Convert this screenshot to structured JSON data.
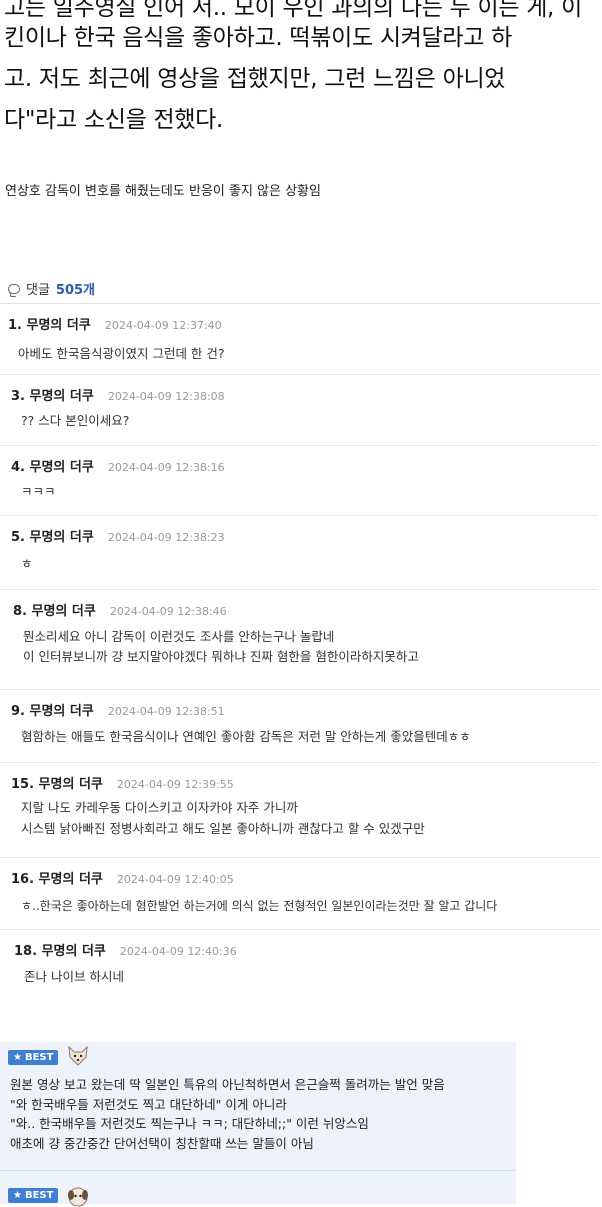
{
  "article": {
    "lines": [
      "고는 일주영실 인어 서.. 모이 우인 과의의 다는 두 이는 게, 이",
      "킨이나 한국 음식을 좋아하고. 떡볶이도 시켜달라고 하",
      "고. 저도 최근에 영상을 접했지만, 그런 느낌은 아니었",
      "다\"라고 소신을 전했다."
    ],
    "caption": "연상호 감독이 변호를 해줬는데도 반응이 좋지 않은 상황임"
  },
  "comments_header": {
    "label": "댓글",
    "count": "505개"
  },
  "comments": [
    {
      "author": "1. 무명의 더쿠",
      "date": "2024-04-09 12:37:40",
      "lines": [
        "아베도 한국음식광이였지 그런데 한 건?"
      ]
    },
    {
      "author": "3. 무명의 더쿠",
      "date": "2024-04-09 12:38:08",
      "lines": [
        "?? 스다 본인이세요?"
      ]
    },
    {
      "author": "4. 무명의 더쿠",
      "date": "2024-04-09 12:38:16",
      "lines": [
        "ㅋㅋㅋ"
      ]
    },
    {
      "author": "5. 무명의 더쿠",
      "date": "2024-04-09 12:38:23",
      "lines": [
        "ㅎ"
      ]
    },
    {
      "author": "8. 무명의 더쿠",
      "date": "2024-04-09 12:38:46",
      "lines": [
        "뭔소리세요 아니 감독이 이런것도 조사를 안하는구나 놀랍네",
        "이 인터뷰보니까 걍 보지말아야겠다 뭐하냐 진짜 혐한을 혐한이라하지못하고"
      ]
    },
    {
      "author": "9. 무명의 더쿠",
      "date": "2024-04-09 12:38:51",
      "lines": [
        "혐함하는 애들도 한국음식이나 연예인 좋아함 감독은 저런 말 안하는게 좋았을텐데ㅎㅎ"
      ]
    },
    {
      "author": "15. 무명의 더쿠",
      "date": "2024-04-09 12:39:55",
      "lines": [
        "지랄 나도 카레우동 다이스키고 이자카야 자주 가니까",
        "시스템 낡아빠진 정병사회라고 해도 일본 좋아하니까 괜찮다고 할 수 있겠구만"
      ]
    },
    {
      "author": "16. 무명의 더쿠",
      "date": "2024-04-09 12:40:05",
      "lines": [
        "ㅎ..한국은 좋아하는데 혐한발언 하는거에 의식 없는 전형적인 일본인이라는것만 잘 알고 갑니다"
      ]
    },
    {
      "author": "18. 무명의 더쿠",
      "date": "2024-04-09 12:40:36",
      "lines": [
        "존나 나이브 하시네"
      ]
    }
  ],
  "best": [
    {
      "badge": "BEST",
      "avatar_icon": "dog-avatar-icon",
      "lines": [
        "원본 영상 보고 왔는데 딱 일본인 특유의 아닌척하면서 은근슬쩍 돌려까는 발언 맞음",
        "\"와 한국배우들 저런것도 찍고 대단하네\" 이게 아니라",
        "\"와.. 한국배우들 저런것도 찍는구나 ㅋㅋ; 대단하네;;\" 이런 뉘앙스임",
        "애초에 걍 중간중간 단어선택이 칭찬할때 쓰는 말들이 아님"
      ]
    },
    {
      "badge": "BEST",
      "avatar_icon": "puppy-avatar-icon",
      "lines": []
    }
  ],
  "colors": {
    "best_bg": "#eef3fb",
    "badge": "#3f7fd4",
    "count": "#2a5aa8"
  }
}
